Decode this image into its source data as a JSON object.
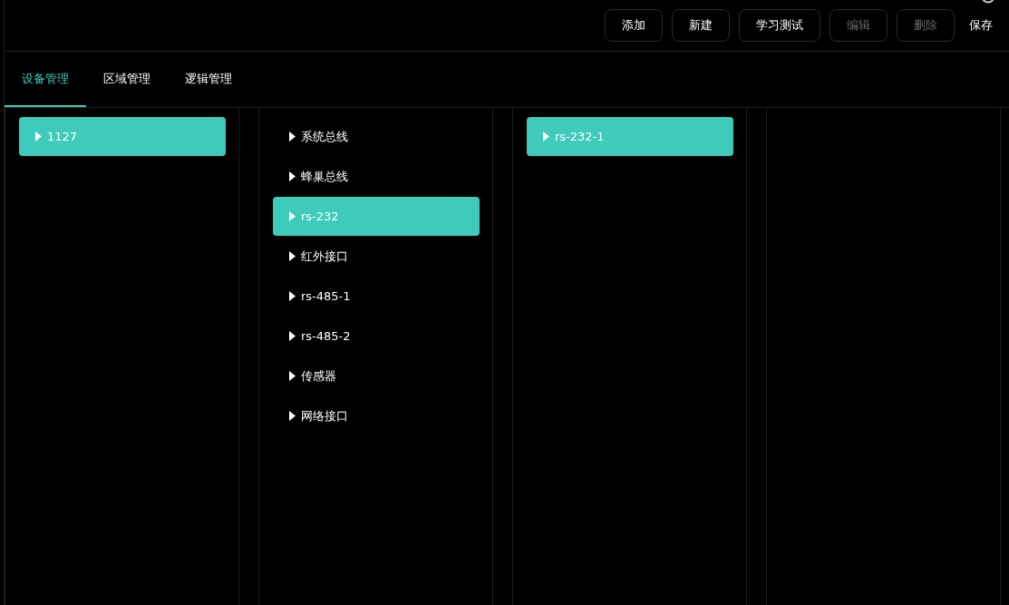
{
  "toolbar": {
    "buttons": [
      {
        "label": "添加",
        "kind": "outlined",
        "disabled": false
      },
      {
        "label": "新建",
        "kind": "outlined",
        "disabled": false
      },
      {
        "label": "学习测试",
        "kind": "outlined",
        "disabled": false
      },
      {
        "label": "编辑",
        "kind": "outlined",
        "disabled": true
      },
      {
        "label": "删除",
        "kind": "outlined",
        "disabled": true
      },
      {
        "label": "保存",
        "kind": "plain",
        "disabled": false
      }
    ]
  },
  "tabs": [
    {
      "label": "设备管理",
      "selected": true
    },
    {
      "label": "区域管理",
      "selected": false
    },
    {
      "label": "逻辑管理",
      "selected": false
    }
  ],
  "columns": [
    {
      "items": [
        {
          "label": "1127",
          "selected": true
        }
      ]
    },
    {
      "items": [
        {
          "label": "系统总线",
          "selected": false
        },
        {
          "label": "蜂巢总线",
          "selected": false
        },
        {
          "label": "rs-232",
          "selected": true
        },
        {
          "label": "红外接口",
          "selected": false
        },
        {
          "label": "rs-485-1",
          "selected": false
        },
        {
          "label": "rs-485-2",
          "selected": false
        },
        {
          "label": "传感器",
          "selected": false
        },
        {
          "label": "网络接口",
          "selected": false
        }
      ]
    },
    {
      "items": [
        {
          "label": "rs-232-1",
          "selected": true
        }
      ]
    },
    {}
  ]
}
